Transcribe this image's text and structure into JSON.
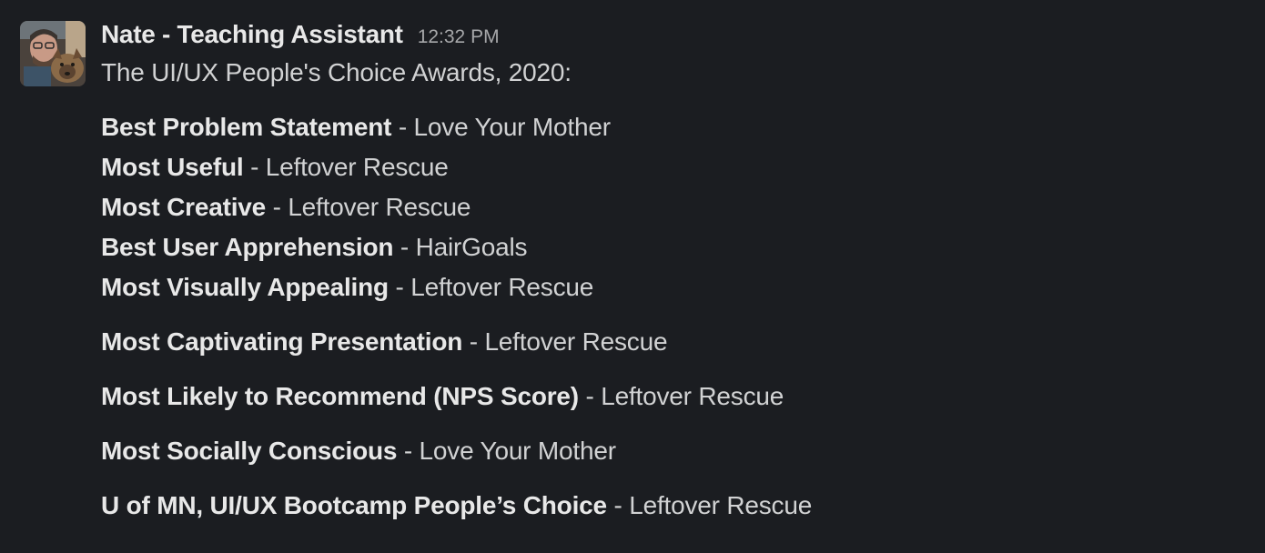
{
  "message": {
    "author": "Nate - Teaching Assistant",
    "timestamp": "12:32 PM",
    "intro": "The UI/UX People's Choice Awards, 2020:",
    "separator": " - ",
    "awards": [
      {
        "category": "Best Problem Statement",
        "winner": "Love Your Mother"
      },
      {
        "category": "Most Useful",
        "winner": "Leftover Rescue"
      },
      {
        "category": "Most Creative",
        "winner": "Leftover Rescue"
      },
      {
        "category": "Best User Apprehension",
        "winner": "HairGoals"
      },
      {
        "category": "Most Visually Appealing",
        "winner": "Leftover Rescue"
      },
      {
        "category": "Most Captivating Presentation",
        "winner": "Leftover Rescue"
      },
      {
        "category": "Most Likely to Recommend (NPS Score)",
        "winner": "Leftover Rescue"
      },
      {
        "category": "Most Socially Conscious",
        "winner": "Love Your Mother"
      },
      {
        "category": "U of MN, UI/UX Bootcamp People’s Choice",
        "winner": "Leftover Rescue"
      }
    ]
  }
}
